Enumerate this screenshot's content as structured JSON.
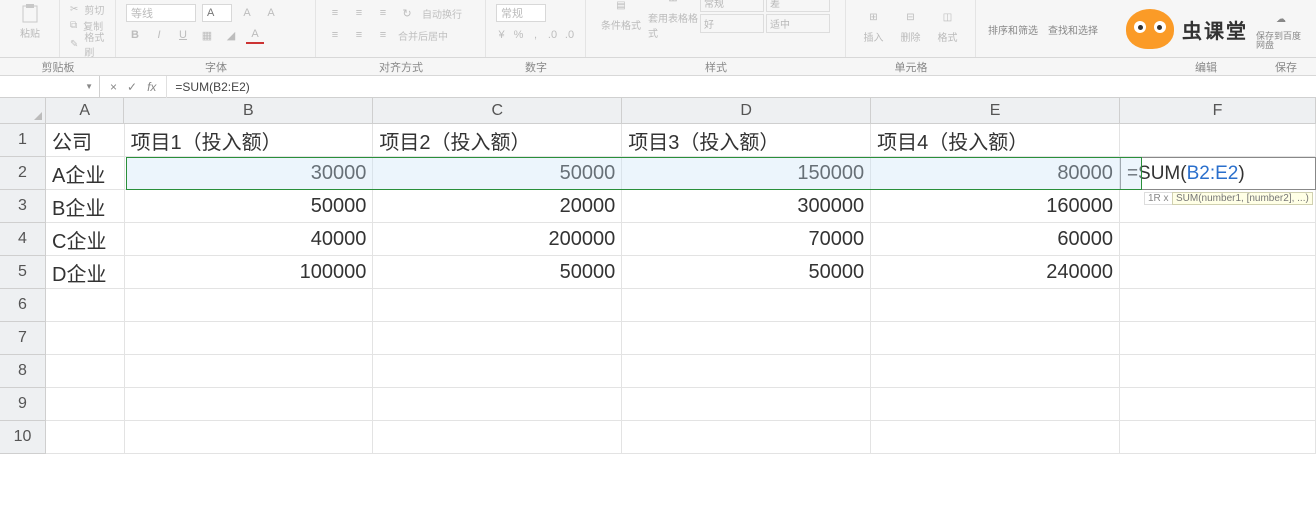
{
  "ribbon": {
    "clipboard": {
      "paste": "粘贴",
      "cut": "剪切",
      "copy": "复制",
      "format_painter": "格式刷",
      "group": "剪贴板"
    },
    "font": {
      "family": "等线",
      "size": "",
      "placeholder_size": "A",
      "group": "字体"
    },
    "alignment": {
      "wrap": "自动换行",
      "merge": "合并后居中",
      "group": "对齐方式"
    },
    "number": {
      "format": "常规",
      "group": "数字"
    },
    "styles": {
      "cond": "条件格式",
      "table": "套用表格格式",
      "normal": "常规",
      "good": "好",
      "bad": "差",
      "neutral": "适中",
      "group": "样式"
    },
    "cells": {
      "insert": "插入",
      "delete": "删除",
      "format": "格式",
      "group": "单元格"
    },
    "editing": {
      "sort": "排序和筛选",
      "find": "查找和选择",
      "group": "编辑"
    },
    "save": {
      "label": "保存到百度网盘",
      "group": "保存"
    },
    "brand": "虫课堂"
  },
  "formula_bar": {
    "name_box": "",
    "cancel_icon": "×",
    "accept_icon": "✓",
    "fx_icon": "fx",
    "formula": "=SUM(B2:E2)"
  },
  "columns": [
    "A",
    "B",
    "C",
    "D",
    "E",
    "F"
  ],
  "row_numbers": [
    1,
    2,
    3,
    4,
    5,
    6,
    7,
    8,
    9,
    10
  ],
  "headers": {
    "A": "公司",
    "B": "项目1（投入额）",
    "C": "项目2（投入额）",
    "D": "项目3（投入额）",
    "E": "项目4（投入额）"
  },
  "rows": [
    {
      "A": "A企业",
      "B": "30000",
      "C": "50000",
      "D": "150000",
      "E": "80000"
    },
    {
      "A": "B企业",
      "B": "50000",
      "C": "20000",
      "D": "300000",
      "E": "160000"
    },
    {
      "A": "C企业",
      "B": "40000",
      "C": "200000",
      "D": "70000",
      "E": "60000"
    },
    {
      "A": "D企业",
      "B": "100000",
      "C": "50000",
      "D": "50000",
      "E": "240000"
    }
  ],
  "active_formula": {
    "prefix": "=SUM(",
    "ref": "B2:E2",
    "suffix": ")"
  },
  "tooltip": "SUM(number1, [number2], ...)",
  "sel_size": "1R x"
}
